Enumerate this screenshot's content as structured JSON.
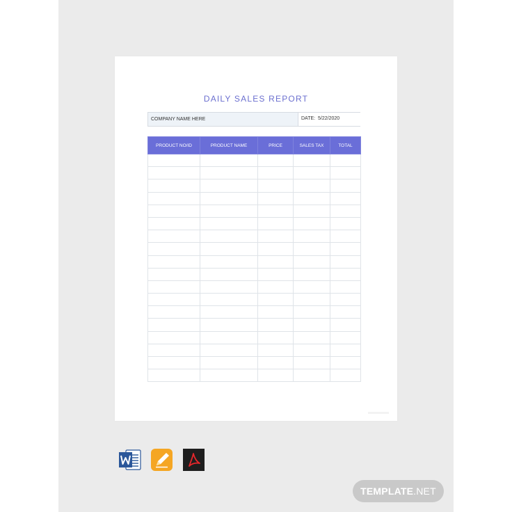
{
  "document": {
    "title": "DAILY SALES REPORT",
    "company_label": "COMPANY NAME HERE",
    "date_label": "DATE:",
    "date_value": "5/22/2020",
    "table": {
      "headers": [
        "PRODUCT NO/ID",
        "PRODUCT NAME",
        "PRICE",
        "SALES TAX",
        "TOTAL"
      ],
      "empty_row_count": 18
    },
    "colors": {
      "accent": "#6a6ed8",
      "title": "#6b6fcf"
    }
  },
  "formats": [
    {
      "name": "Word",
      "icon": "word-icon",
      "color": "#2b579a"
    },
    {
      "name": "Pages",
      "icon": "pages-icon",
      "color": "#f5a623"
    },
    {
      "name": "PDF",
      "icon": "pdf-icon",
      "color": "#1e1e1e"
    }
  ],
  "brand": {
    "main": "TEMPLATE",
    "suffix": ".NET"
  }
}
